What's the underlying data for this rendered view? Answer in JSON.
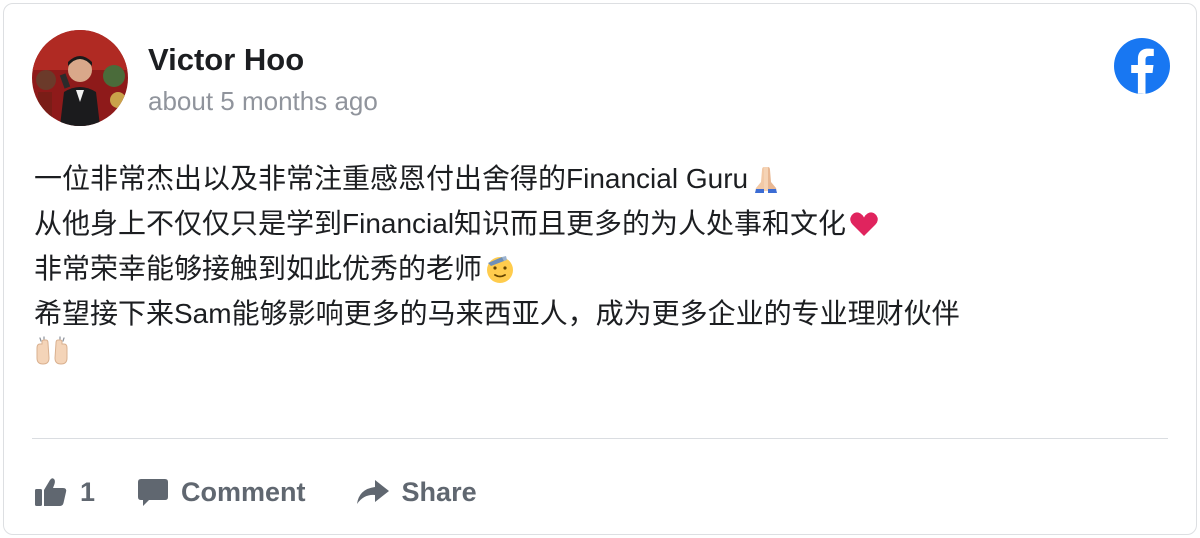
{
  "post": {
    "author": "Victor Hoo",
    "timestamp": "about 5 months ago",
    "platform_icon": "facebook-icon",
    "avatar_icon": "profile-photo",
    "lines": [
      {
        "text": "一位非常杰出以及非常注重感恩付出舍得的Financial Guru",
        "emoji": "folded-hands-icon"
      },
      {
        "text": "从他身上不仅仅只是学到Financial知识而且更多的为人处事和文化",
        "emoji": "red-heart-icon"
      },
      {
        "text": "非常荣幸能够接触到如此优秀的老师",
        "emoji": "saluting-face-icon"
      },
      {
        "text": "希望接下来Sam能够影响更多的马来西亚人，成为更多企业的专业理财伙伴",
        "emoji": ""
      },
      {
        "text": "",
        "emoji": "raising-hands-icon"
      }
    ]
  },
  "actions": {
    "like_count": "1",
    "like_icon": "thumbs-up-icon",
    "comment_label": "Comment",
    "comment_icon": "comment-icon",
    "share_label": "Share",
    "share_icon": "share-arrow-icon"
  },
  "colors": {
    "facebook_blue": "#1877f2",
    "text_primary": "#1c1e21",
    "text_secondary": "#90949c",
    "action_gray": "#606770",
    "heart_red": "#e0245e"
  }
}
